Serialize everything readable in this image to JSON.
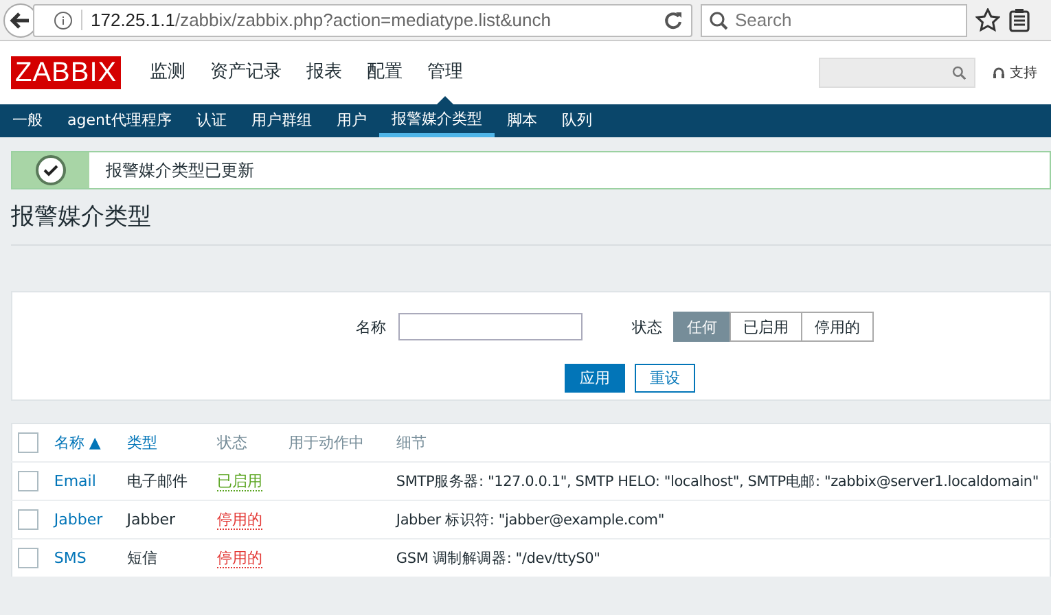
{
  "browser": {
    "url_host": "172.25.1.1",
    "url_path": "/zabbix/zabbix.php?action=mediatype.list&unch",
    "search_placeholder": "Search"
  },
  "header": {
    "logo": "ZABBIX",
    "menu": [
      {
        "label": "监测",
        "selected": false
      },
      {
        "label": "资产记录",
        "selected": false
      },
      {
        "label": "报表",
        "selected": false
      },
      {
        "label": "配置",
        "selected": false
      },
      {
        "label": "管理",
        "selected": true
      }
    ],
    "support": "支持"
  },
  "submenu": [
    {
      "label": "一般",
      "selected": false
    },
    {
      "label": "agent代理程序",
      "selected": false
    },
    {
      "label": "认证",
      "selected": false
    },
    {
      "label": "用户群组",
      "selected": false
    },
    {
      "label": "用户",
      "selected": false
    },
    {
      "label": "报警媒介类型",
      "selected": true
    },
    {
      "label": "脚本",
      "selected": false
    },
    {
      "label": "队列",
      "selected": false
    }
  ],
  "message": "报警媒介类型已更新",
  "title": "报警媒介类型",
  "filter": {
    "name_label": "名称",
    "status_label": "状态",
    "status_options": [
      {
        "label": "任何",
        "selected": true
      },
      {
        "label": "已启用",
        "selected": false
      },
      {
        "label": "停用的",
        "selected": false
      }
    ],
    "apply": "应用",
    "reset": "重设"
  },
  "table": {
    "select_all_checked": false,
    "columns": [
      "名称 ▲",
      "类型",
      "状态",
      "用于动作中",
      "细节"
    ],
    "rows": [
      {
        "name": "Email",
        "type": "电子邮件",
        "status": "已启用",
        "enabled": true,
        "details": "SMTP服务器: \"127.0.0.1\", SMTP HELO: \"localhost\", SMTP电邮: \"zabbix@server1.localdomain\"",
        "checked": false
      },
      {
        "name": "Jabber",
        "type": "Jabber",
        "status": "停用的",
        "enabled": false,
        "details": "Jabber 标识符: \"jabber@example.com\"",
        "checked": false
      },
      {
        "name": "SMS",
        "type": "短信",
        "status": "停用的",
        "enabled": false,
        "details": "GSM 调制解调器: \"/dev/ttyS0\"",
        "checked": false
      }
    ]
  }
}
